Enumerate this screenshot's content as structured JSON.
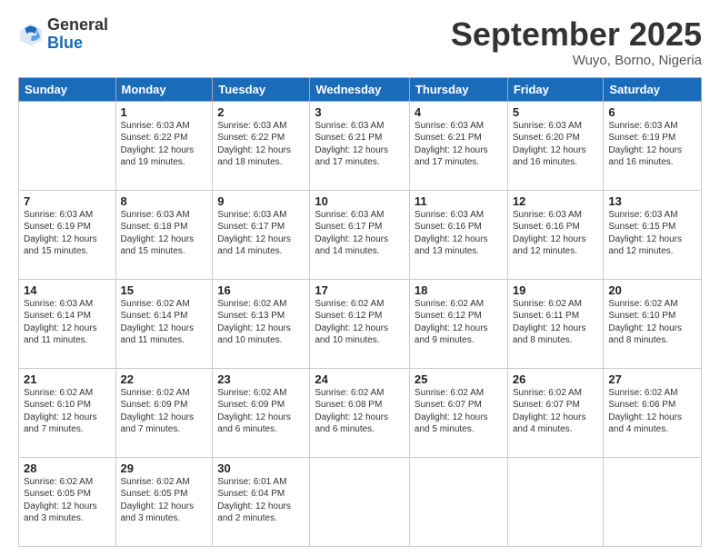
{
  "logo": {
    "general": "General",
    "blue": "Blue"
  },
  "title": "September 2025",
  "location": "Wuyo, Borno, Nigeria",
  "days_of_week": [
    "Sunday",
    "Monday",
    "Tuesday",
    "Wednesday",
    "Thursday",
    "Friday",
    "Saturday"
  ],
  "weeks": [
    [
      null,
      {
        "num": "1",
        "rise": "6:03 AM",
        "set": "6:22 PM",
        "daylight": "12 hours and 19 minutes."
      },
      {
        "num": "2",
        "rise": "6:03 AM",
        "set": "6:22 PM",
        "daylight": "12 hours and 18 minutes."
      },
      {
        "num": "3",
        "rise": "6:03 AM",
        "set": "6:21 PM",
        "daylight": "12 hours and 17 minutes."
      },
      {
        "num": "4",
        "rise": "6:03 AM",
        "set": "6:21 PM",
        "daylight": "12 hours and 17 minutes."
      },
      {
        "num": "5",
        "rise": "6:03 AM",
        "set": "6:20 PM",
        "daylight": "12 hours and 16 minutes."
      },
      {
        "num": "6",
        "rise": "6:03 AM",
        "set": "6:19 PM",
        "daylight": "12 hours and 16 minutes."
      }
    ],
    [
      {
        "num": "7",
        "rise": "6:03 AM",
        "set": "6:19 PM",
        "daylight": "12 hours and 15 minutes."
      },
      {
        "num": "8",
        "rise": "6:03 AM",
        "set": "6:18 PM",
        "daylight": "12 hours and 15 minutes."
      },
      {
        "num": "9",
        "rise": "6:03 AM",
        "set": "6:17 PM",
        "daylight": "12 hours and 14 minutes."
      },
      {
        "num": "10",
        "rise": "6:03 AM",
        "set": "6:17 PM",
        "daylight": "12 hours and 14 minutes."
      },
      {
        "num": "11",
        "rise": "6:03 AM",
        "set": "6:16 PM",
        "daylight": "12 hours and 13 minutes."
      },
      {
        "num": "12",
        "rise": "6:03 AM",
        "set": "6:16 PM",
        "daylight": "12 hours and 12 minutes."
      },
      {
        "num": "13",
        "rise": "6:03 AM",
        "set": "6:15 PM",
        "daylight": "12 hours and 12 minutes."
      }
    ],
    [
      {
        "num": "14",
        "rise": "6:03 AM",
        "set": "6:14 PM",
        "daylight": "12 hours and 11 minutes."
      },
      {
        "num": "15",
        "rise": "6:02 AM",
        "set": "6:14 PM",
        "daylight": "12 hours and 11 minutes."
      },
      {
        "num": "16",
        "rise": "6:02 AM",
        "set": "6:13 PM",
        "daylight": "12 hours and 10 minutes."
      },
      {
        "num": "17",
        "rise": "6:02 AM",
        "set": "6:12 PM",
        "daylight": "12 hours and 10 minutes."
      },
      {
        "num": "18",
        "rise": "6:02 AM",
        "set": "6:12 PM",
        "daylight": "12 hours and 9 minutes."
      },
      {
        "num": "19",
        "rise": "6:02 AM",
        "set": "6:11 PM",
        "daylight": "12 hours and 8 minutes."
      },
      {
        "num": "20",
        "rise": "6:02 AM",
        "set": "6:10 PM",
        "daylight": "12 hours and 8 minutes."
      }
    ],
    [
      {
        "num": "21",
        "rise": "6:02 AM",
        "set": "6:10 PM",
        "daylight": "12 hours and 7 minutes."
      },
      {
        "num": "22",
        "rise": "6:02 AM",
        "set": "6:09 PM",
        "daylight": "12 hours and 7 minutes."
      },
      {
        "num": "23",
        "rise": "6:02 AM",
        "set": "6:09 PM",
        "daylight": "12 hours and 6 minutes."
      },
      {
        "num": "24",
        "rise": "6:02 AM",
        "set": "6:08 PM",
        "daylight": "12 hours and 6 minutes."
      },
      {
        "num": "25",
        "rise": "6:02 AM",
        "set": "6:07 PM",
        "daylight": "12 hours and 5 minutes."
      },
      {
        "num": "26",
        "rise": "6:02 AM",
        "set": "6:07 PM",
        "daylight": "12 hours and 4 minutes."
      },
      {
        "num": "27",
        "rise": "6:02 AM",
        "set": "6:06 PM",
        "daylight": "12 hours and 4 minutes."
      }
    ],
    [
      {
        "num": "28",
        "rise": "6:02 AM",
        "set": "6:05 PM",
        "daylight": "12 hours and 3 minutes."
      },
      {
        "num": "29",
        "rise": "6:02 AM",
        "set": "6:05 PM",
        "daylight": "12 hours and 3 minutes."
      },
      {
        "num": "30",
        "rise": "6:01 AM",
        "set": "6:04 PM",
        "daylight": "12 hours and 2 minutes."
      },
      null,
      null,
      null,
      null
    ]
  ]
}
